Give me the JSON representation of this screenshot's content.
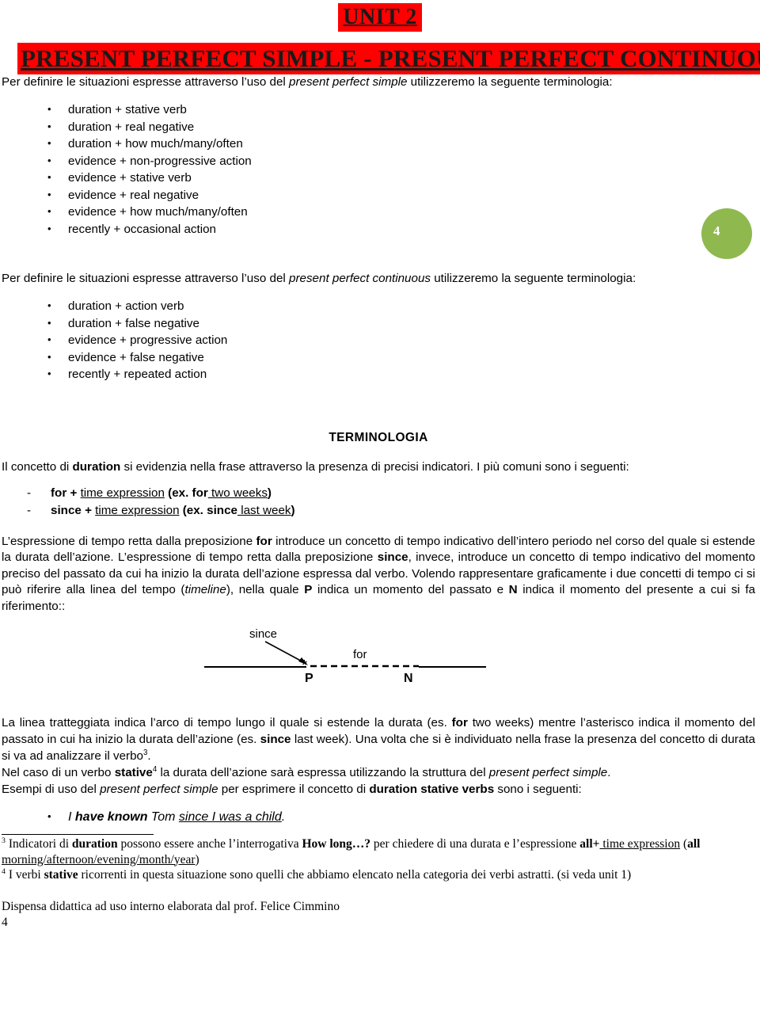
{
  "header": {
    "unit_label": "UNIT 2",
    "main_title": "PRESENT PERFECT SIMPLE - PRESENT PERFECT CONTINUOUS",
    "highlight_color": "#ff0000",
    "title_text_color": "#1a1a1a"
  },
  "badge": {
    "number": "4",
    "color": "#8fb94f"
  },
  "section_simple": {
    "intro_before": "Per definire le situazioni espresse attraverso l’uso del ",
    "intro_italic": "present perfect simple",
    "intro_after": " utilizzeremo la seguente terminologia:",
    "bullets": [
      "duration +  stative verb",
      "duration +  real negative",
      "duration + how much/many/often",
      "evidence + non-progressive action",
      "evidence + stative verb",
      "evidence + real negative",
      "evidence + how much/many/often",
      "recently + occasional action"
    ]
  },
  "section_continuous": {
    "intro_before": "Per definire le situazioni espresse attraverso l’uso del ",
    "intro_italic": "present perfect continuous",
    "intro_after": " utilizzeremo la seguente terminologia:",
    "bullets": [
      "duration + action verb",
      "duration + false negative",
      "evidence +  progressive action",
      "evidence + false negative",
      "recently + repeated action"
    ]
  },
  "terminologia": {
    "heading": "TERMINOLOGIA",
    "lead_1": "Il concetto di ",
    "lead_bold": "duration",
    "lead_2": " si evidenzia nella frase attraverso la presenza di precisi indicatori. I più comuni sono i seguenti:",
    "items": [
      {
        "keyword": "for",
        "plus": " + ",
        "underlined": "time expression",
        "example_open": " (ex. ",
        "example_keyword": "for",
        "example_underlined": " two weeks",
        "example_close": ")"
      },
      {
        "keyword": "since",
        "plus": " + ",
        "underlined": "time expression",
        "example_open": " (ex. ",
        "example_keyword": "since",
        "example_underlined": " last week",
        "example_close": ")"
      }
    ]
  },
  "explanation": {
    "p1_a": "L’espressione di tempo retta dalla preposizione ",
    "p1_for": "for",
    "p1_b": " introduce un concetto di tempo indicativo dell’intero periodo nel corso del quale si estende la durata dell’azione. L’espressione di tempo retta dalla preposizione ",
    "p1_since": "since",
    "p1_c": ", invece, introduce un concetto di tempo indicativo del momento preciso del passato da cui ha inizio la durata dell’azione espressa dal verbo. Volendo rappresentare graficamente i due concetti di tempo ci si può riferire alla linea del tempo (",
    "p1_timeline": "timeline",
    "p1_d": "), nella quale ",
    "p1_P": "P",
    "p1_e": " indica un momento del passato e ",
    "p1_N": "N",
    "p1_f": " indica il momento del presente a cui si fa riferimento::"
  },
  "timeline_figure": {
    "since_label": "since",
    "for_label": "for",
    "past_label": "P",
    "now_label": "N",
    "asterisk": "*"
  },
  "explanation_2": {
    "t_a": "La linea tratteggiata indica l’arco di tempo lungo il quale si estende la durata (es. ",
    "t_for": "for",
    "t_b": " two weeks) mentre l’asterisco indica il momento del passato in cui ha inizio la durata dell’azione (es. ",
    "t_since": "since",
    "t_c": " last week). Una volta che si è individuato nella frase la presenza del concetto di durata si va ad analizzare il verbo",
    "t_sup3": "3",
    "t_d": ".",
    "t2_a": "Nel caso di un verbo ",
    "t2_stative": "stative",
    "t2_sup4": "4",
    "t2_b": " la durata dell’azione sarà espressa utilizzando la struttura del ",
    "t2_italic": "present perfect simple",
    "t2_c": ".",
    "t3_a": "Esempi di uso del ",
    "t3_italic": "present perfect simple",
    "t3_b": " per esprimere il concetto di ",
    "t3_bold": "duration stative verbs",
    "t3_c": "  sono i seguenti:"
  },
  "examples": {
    "items": [
      {
        "pre": "I ",
        "bold": "have known",
        "mid": " Tom ",
        "underlined": "since I was a child",
        "post": "."
      }
    ]
  },
  "footnotes": [
    {
      "marker": "3",
      "a": " Indicatori di ",
      "bold1": "duration",
      "b": " possono essere anche l’interrogativa ",
      "bold2": "How long…?",
      "c": " per chiedere di una durata e l’espressione ",
      "bold3": "all+",
      "underlined1": " time expression",
      "d": " (",
      "bold4": "all",
      "underlined2": " morning/afternoon/evening/month/year",
      "e": ")"
    },
    {
      "marker": "4",
      "a": " I verbi ",
      "bold1": "stative",
      "b": " ricorrenti in questa situazione sono quelli che abbiamo elencato nella categoria dei verbi astratti. (si veda unit 1)"
    }
  ],
  "footer": {
    "note": "Dispensa didattica ad uso interno elaborata dal prof. Felice Cimmino",
    "page_number": "4"
  }
}
